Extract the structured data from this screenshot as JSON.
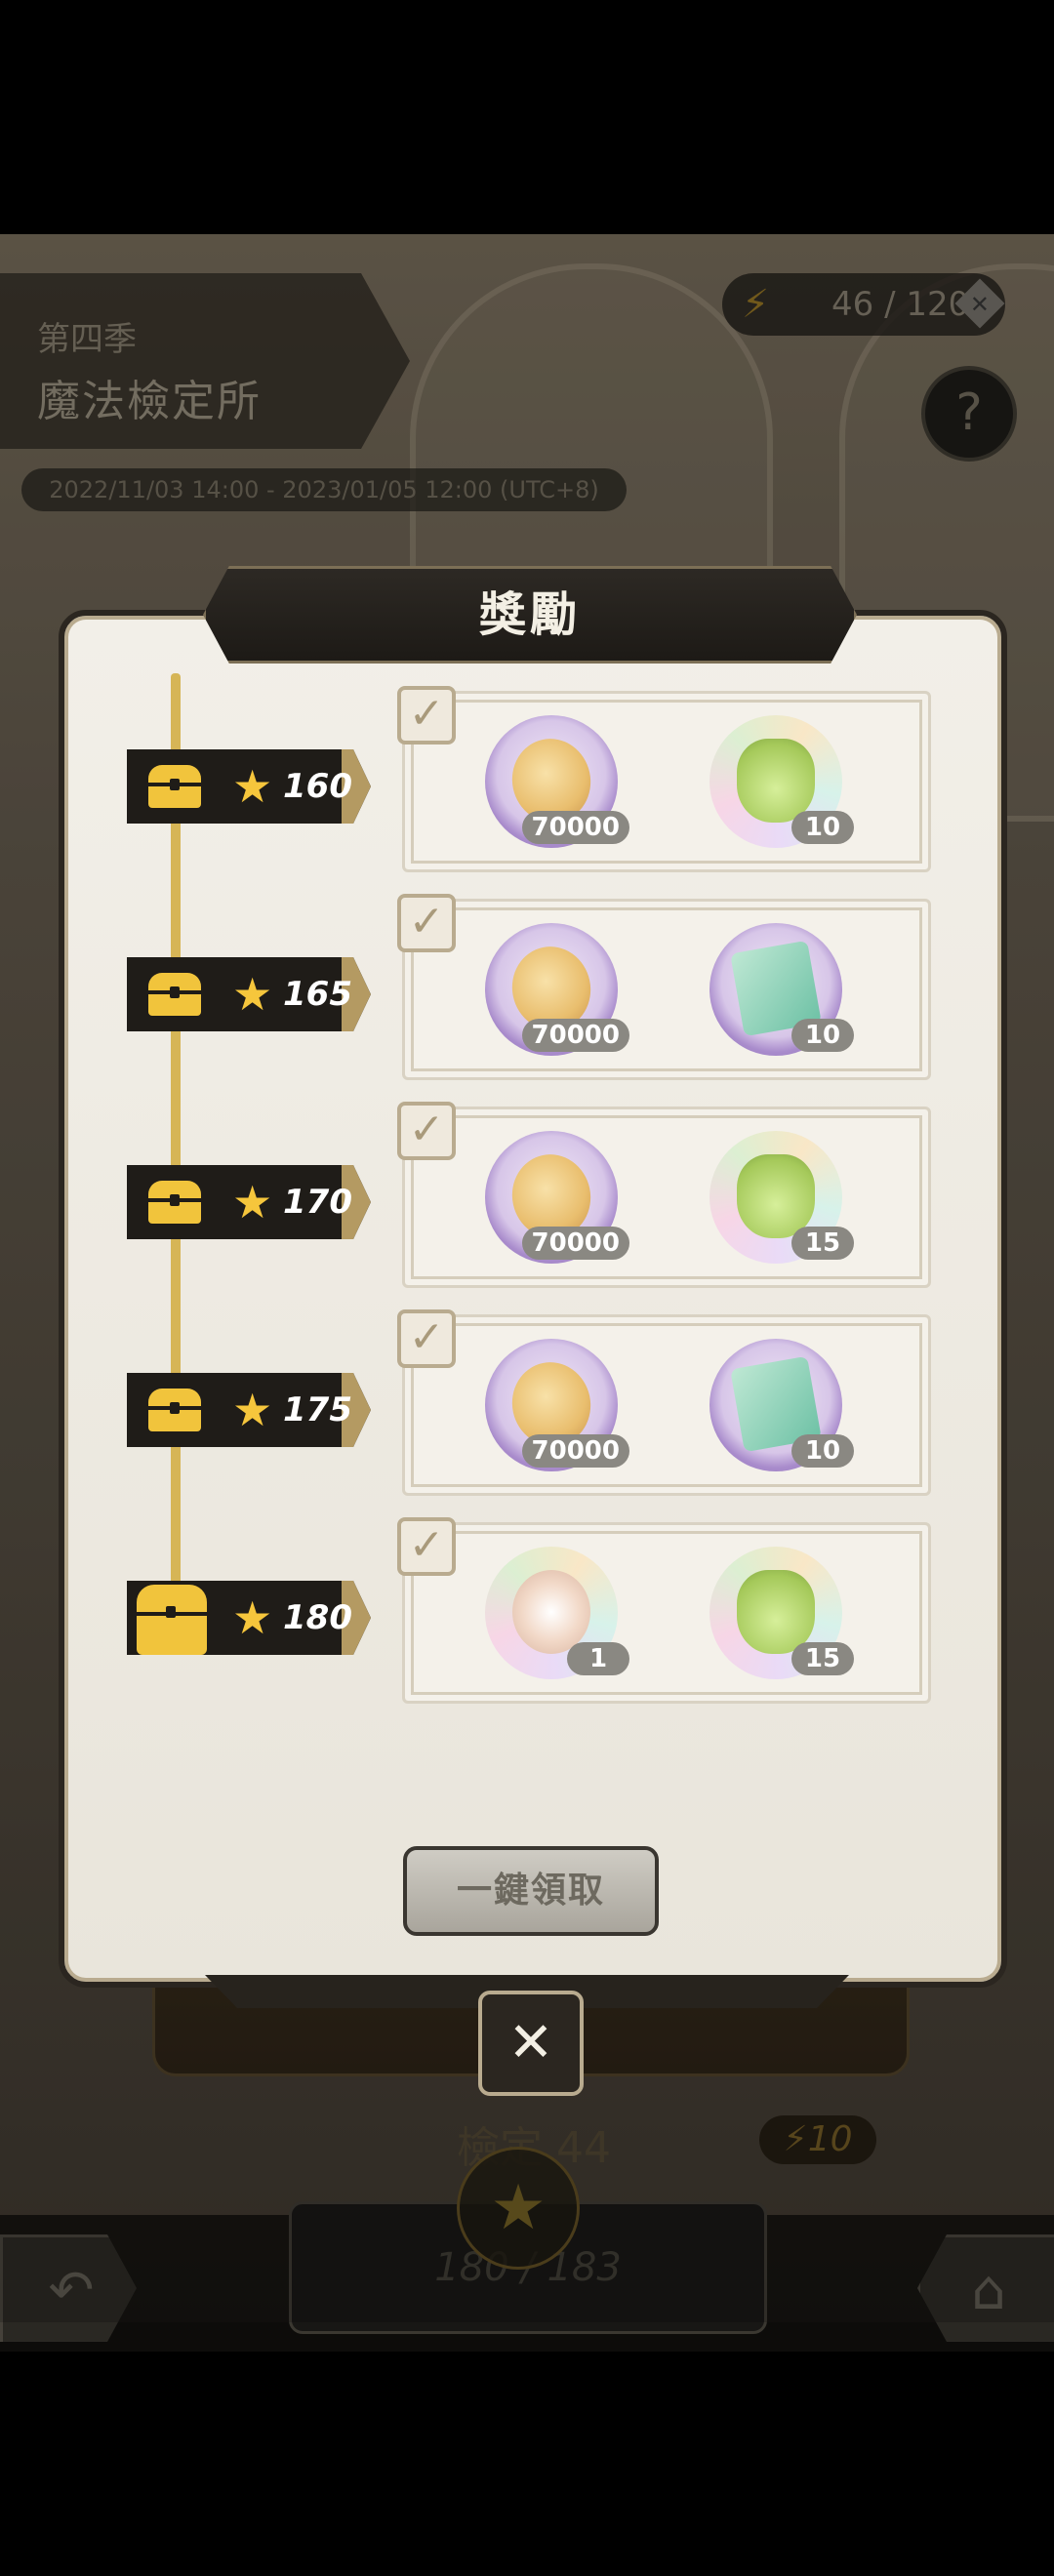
{
  "background": {
    "season_label": "第四季",
    "event_title": "魔法檢定所",
    "date_range": "2022/11/03 14:00 - 2023/01/05 12:00 (UTC+8)",
    "energy": "46 / 120",
    "stage_label": "檢定 44",
    "stage_energy": "10",
    "star_progress": "180 / 183"
  },
  "modal": {
    "title": "獎勵",
    "claim_all_label": "一鍵領取",
    "close_symbol": "✕",
    "tiers": [
      {
        "stars": "160",
        "rewards": [
          {
            "icon": "gold-coin-icon",
            "qty": "70000"
          },
          {
            "icon": "potion-icon",
            "qty": "10"
          }
        ]
      },
      {
        "stars": "165",
        "rewards": [
          {
            "icon": "gold-coin-icon",
            "qty": "70000"
          },
          {
            "icon": "ticket-icon",
            "qty": "10"
          }
        ]
      },
      {
        "stars": "170",
        "rewards": [
          {
            "icon": "gold-coin-icon",
            "qty": "70000"
          },
          {
            "icon": "potion-icon",
            "qty": "15"
          }
        ]
      },
      {
        "stars": "175",
        "rewards": [
          {
            "icon": "gold-coin-icon",
            "qty": "70000"
          },
          {
            "icon": "ticket-icon",
            "qty": "10"
          }
        ]
      },
      {
        "stars": "180",
        "rewards": [
          {
            "icon": "crystal-icon",
            "qty": "1"
          },
          {
            "icon": "potion-icon",
            "qty": "15"
          }
        ]
      }
    ]
  },
  "colors": {
    "accent_gold": "#f6c63c",
    "panel_dark": "#1f1c18",
    "panel_light": "#f2efe8"
  }
}
